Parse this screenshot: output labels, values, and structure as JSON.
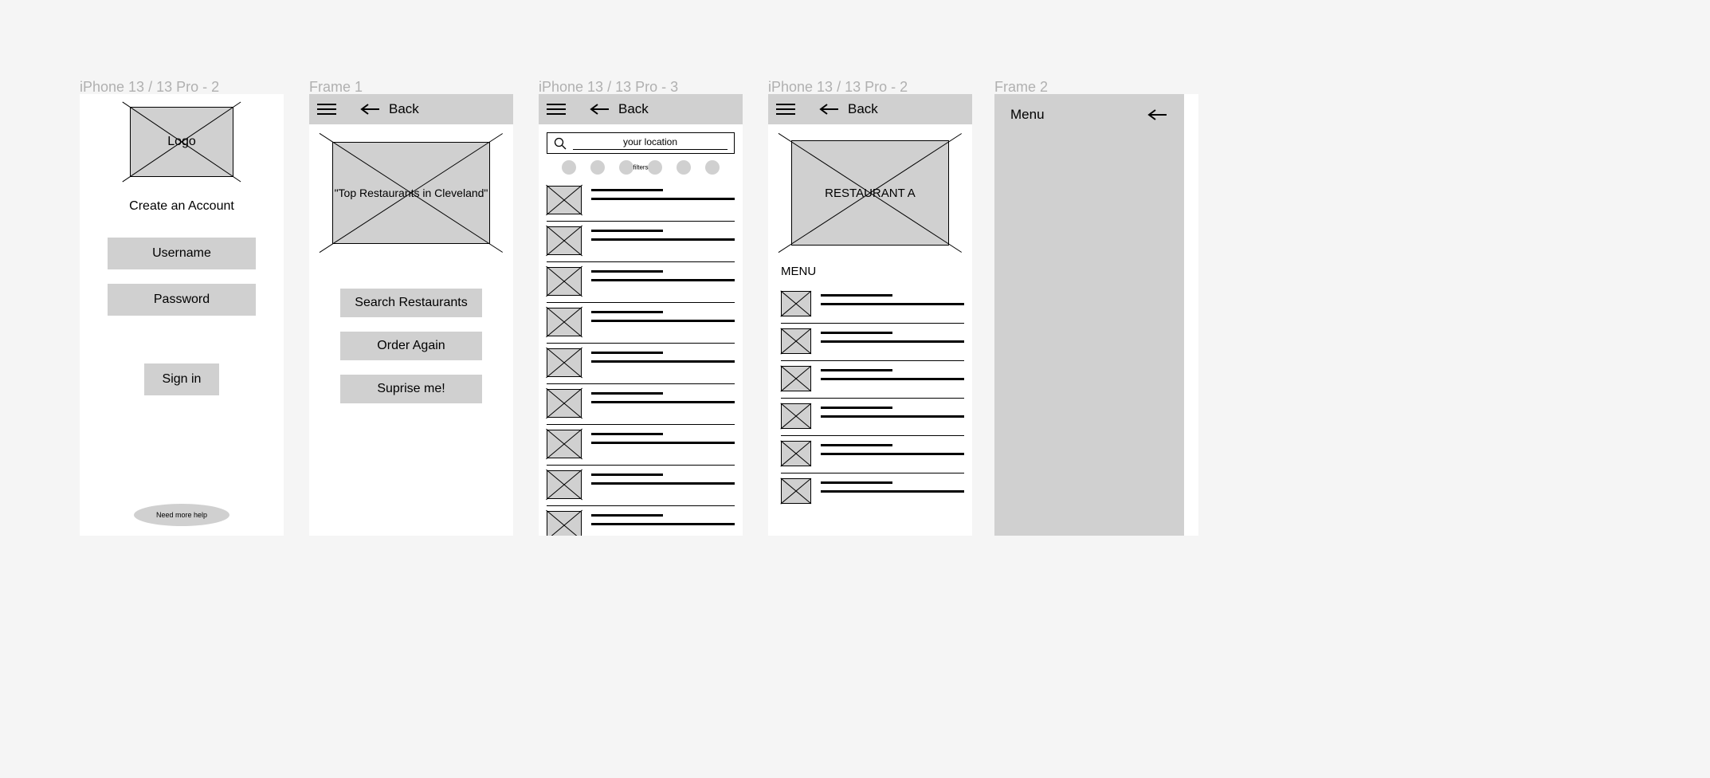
{
  "frames": {
    "f1": {
      "label": "iPhone 13 / 13 Pro - 2"
    },
    "f2": {
      "label": "Frame 1"
    },
    "f3": {
      "label": "iPhone 13 / 13 Pro - 3"
    },
    "f4": {
      "label": "iPhone 13 / 13 Pro - 2"
    },
    "f5": {
      "label": "Frame 2"
    }
  },
  "common": {
    "back": "Back"
  },
  "login": {
    "logo_text": "Logo",
    "title": "Create an Account",
    "username": "Username",
    "password": "Password",
    "signin": "Sign in",
    "help": "Need more help"
  },
  "home": {
    "hero_text": "\"Top Restaurants in Cleveland\"",
    "btn_search": "Search Restaurants",
    "btn_order": "Order Again",
    "btn_surprise": "Suprise me!"
  },
  "search": {
    "placeholder": "your location",
    "filters_label": "filters"
  },
  "restaurant": {
    "name": "RESTAURANT A",
    "menu_heading": "MENU"
  },
  "menu_panel": {
    "title": "Menu"
  }
}
